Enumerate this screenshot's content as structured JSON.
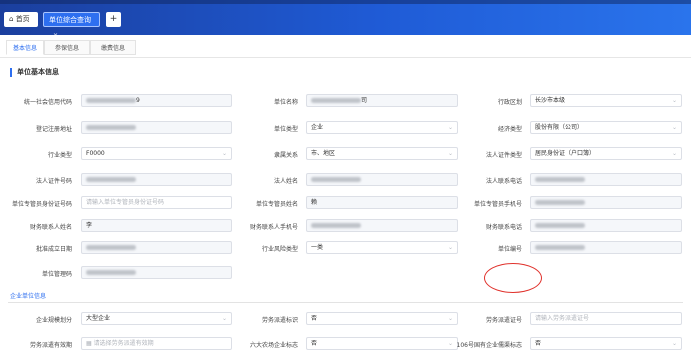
{
  "tabs": {
    "home": "首页",
    "active": "单位综合查询",
    "close_glyph": "×",
    "add_glyph": "+"
  },
  "subtabs": [
    "基本信息",
    "参保信息",
    "缴费信息"
  ],
  "sections": {
    "basic": "单位基本信息",
    "enterprise": "企业单位信息"
  },
  "rows": [
    [
      {
        "label": "统一社会信用代码",
        "value": "9",
        "blurred": true,
        "type": "text"
      },
      {
        "label": "单位名称",
        "value": "司",
        "blurred": true,
        "type": "text"
      },
      {
        "label": "行政区划",
        "value": "长沙市本级",
        "type": "select"
      }
    ],
    [
      {
        "label": "登记注册地址",
        "value": "",
        "blurred": true,
        "type": "text"
      },
      {
        "label": "单位类型",
        "value": "企业",
        "type": "select"
      },
      {
        "label": "经济类型",
        "value": "股份有限（公司）",
        "type": "select"
      }
    ],
    [
      {
        "label": "行业类型",
        "value": "F0000",
        "type": "select"
      },
      {
        "label": "隶属关系",
        "value": "市、地区",
        "type": "select"
      },
      {
        "label": "法人证件类型",
        "value": "居民身份证（户口簿）",
        "type": "select"
      }
    ],
    [
      {
        "label": "法人证件号码",
        "value": "",
        "blurred": true,
        "type": "text"
      },
      {
        "label": "法人姓名",
        "value": "",
        "blurred": true,
        "type": "text"
      },
      {
        "label": "法人联系电话",
        "value": "",
        "blurred": true,
        "type": "text"
      }
    ],
    [
      {
        "label": "单位专管员身份证号码",
        "placeholder": "请输入单位专管员身份证号码",
        "type": "text"
      },
      {
        "label": "单位专管员姓名",
        "value": "赖",
        "type": "text"
      },
      {
        "label": "单位专管员手机号",
        "value": "",
        "blurred": true,
        "type": "text"
      }
    ],
    [
      {
        "label": "财务联系人姓名",
        "value": "李",
        "type": "text"
      },
      {
        "label": "财务联系人手机号",
        "value": "",
        "blurred": true,
        "type": "text"
      },
      {
        "label": "财务联系电话",
        "value": "",
        "blurred": true,
        "type": "text"
      }
    ],
    [
      {
        "label": "批准成立日期",
        "value": "",
        "blurred": true,
        "type": "text"
      },
      {
        "label": "行业风险类型",
        "value": "一类",
        "type": "select"
      },
      {
        "label": "单位编号",
        "value": "",
        "blurred": true,
        "type": "text"
      }
    ],
    [
      {
        "label": "单位管理码",
        "value": "",
        "blurred": true,
        "type": "text"
      }
    ]
  ],
  "enterprise_rows": [
    [
      {
        "label": "企业规模划分",
        "value": "大型企业",
        "type": "select"
      },
      {
        "label": "劳务派遣标识",
        "value": "否",
        "type": "select"
      },
      {
        "label": "劳务派遣证号",
        "placeholder": "请输入劳务派遣证号",
        "type": "text"
      }
    ],
    [
      {
        "label": "劳务派遣有效期",
        "placeholder": "请选择劳务派遣有效期",
        "type": "date"
      },
      {
        "label": "六大农场企业标志",
        "value": "否",
        "type": "select"
      },
      {
        "label": "106号国有企业儒渠标志",
        "value": "否",
        "type": "select"
      }
    ]
  ],
  "icons": {
    "home": "home-icon",
    "chevron": "chevron-down-icon",
    "calendar": "calendar-icon"
  },
  "colors": {
    "accent": "#2e6ff0",
    "header": "#1f5bd6",
    "annotation": "#e0322c"
  }
}
